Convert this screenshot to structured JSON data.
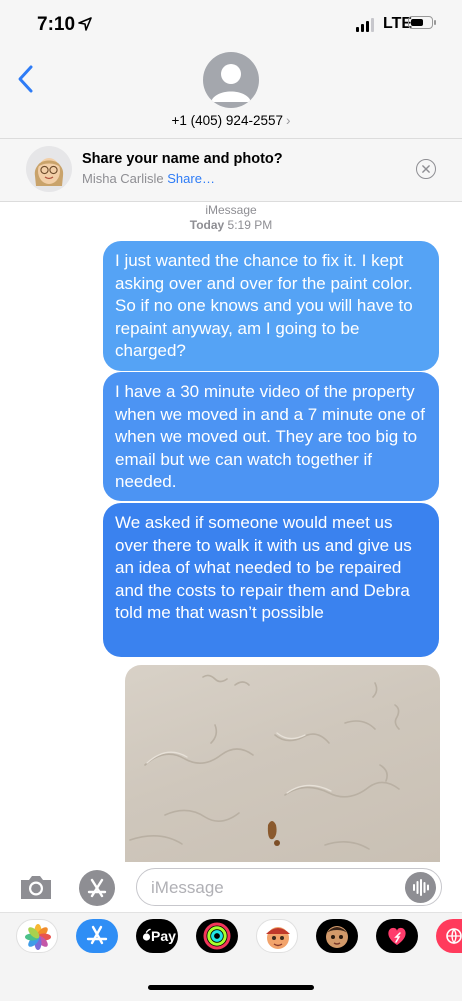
{
  "status_bar": {
    "time": "7:10",
    "network": "LTE"
  },
  "header": {
    "contact": "+1 (405) 924-2557",
    "chevron": "›"
  },
  "share_banner": {
    "title": "Share your name and photo?",
    "name": "Misha Carlisle",
    "link": "Share…"
  },
  "thread": {
    "service": "iMessage",
    "day": "Today",
    "time": "5:19 PM"
  },
  "messages": [
    "I just wanted the chance to fix it. I kept asking over and over for the paint color. So if no one knows and you will have to repaint anyway, am I going to be charged?",
    "I have a 30 minute video of the property when we moved in and a 7 minute one of when we moved out. They are too big to email but we can watch together if needed.",
    "We asked if someone would meet us over there to walk it with us and give us an idea of what needed to be repaired and the costs to repair them and Debra told me that wasn’t possible"
  ],
  "input": {
    "placeholder": "iMessage"
  },
  "apps": [
    {
      "name": "photos-app-icon"
    },
    {
      "name": "app-store-app-icon"
    },
    {
      "name": "apple-pay-app-icon",
      "label": "Pay"
    },
    {
      "name": "activity-app-icon"
    },
    {
      "name": "memoji-app-icon"
    },
    {
      "name": "animoji-app-icon"
    },
    {
      "name": "digital-touch-app-icon"
    },
    {
      "name": "web-app-icon"
    }
  ],
  "colors": {
    "bubble_top": "#55a3f5",
    "bubble_mid": "#4c94f3",
    "bubble_bottom": "#3a82ef",
    "link": "#2e7cf6",
    "secondary_text": "#8e8e93"
  }
}
